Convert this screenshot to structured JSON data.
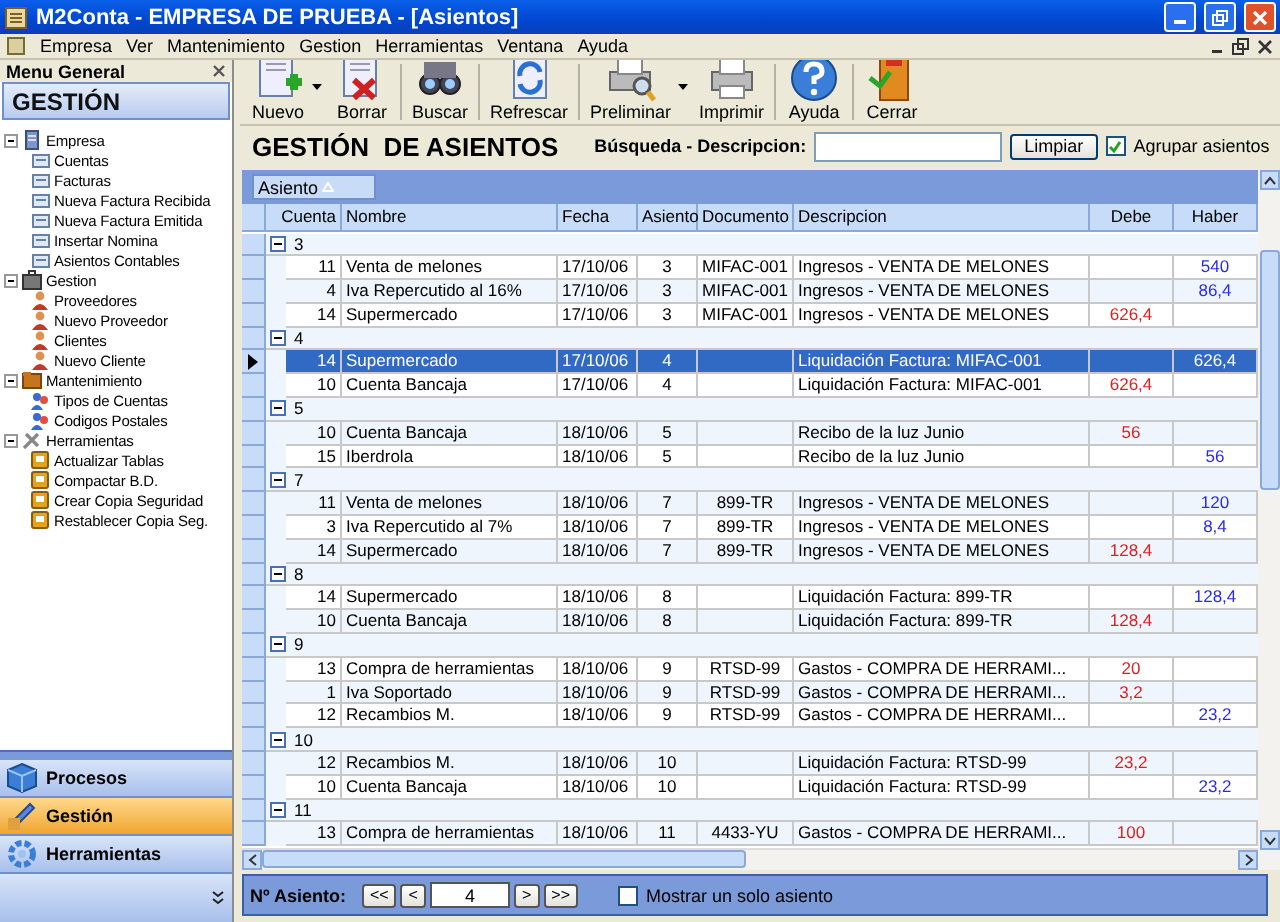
{
  "window": {
    "title": "M2Conta - EMPRESA DE PRUEBA - [Asientos]"
  },
  "menu": [
    "Empresa",
    "Ver",
    "Mantenimiento",
    "Gestion",
    "Herramientas",
    "Ventana",
    "Ayuda"
  ],
  "sidebar": {
    "title": "Menu General",
    "heading": "GESTIÓN",
    "tree": [
      {
        "label": "Empresa",
        "expanded": true,
        "children": [
          {
            "label": "Cuentas"
          },
          {
            "label": "Facturas"
          },
          {
            "label": "Nueva Factura Recibida"
          },
          {
            "label": "Nueva Factura Emitida"
          },
          {
            "label": "Insertar Nomina"
          },
          {
            "label": "Asientos Contables"
          }
        ]
      },
      {
        "label": "Gestion",
        "expanded": true,
        "children": [
          {
            "label": "Proveedores"
          },
          {
            "label": "Nuevo Proveedor"
          },
          {
            "label": "Clientes"
          },
          {
            "label": "Nuevo Cliente"
          }
        ]
      },
      {
        "label": "Mantenimiento",
        "expanded": true,
        "children": [
          {
            "label": "Tipos de Cuentas"
          },
          {
            "label": "Codigos Postales"
          }
        ]
      },
      {
        "label": "Herramientas",
        "expanded": true,
        "children": [
          {
            "label": "Actualizar Tablas"
          },
          {
            "label": "Compactar B.D."
          },
          {
            "label": "Crear Copia Seguridad"
          },
          {
            "label": "Restablecer Copia Seg."
          }
        ]
      }
    ]
  },
  "nav": [
    {
      "label": "Procesos",
      "selected": false
    },
    {
      "label": "Gestión",
      "selected": true
    },
    {
      "label": "Herramientas",
      "selected": false
    }
  ],
  "toolbar": [
    {
      "label": "Nuevo",
      "has_menu": true,
      "separator_after": false
    },
    {
      "label": "Borrar",
      "has_menu": false,
      "separator_after": true
    },
    {
      "label": "Buscar",
      "has_menu": false,
      "separator_after": true
    },
    {
      "label": "Refrescar",
      "has_menu": false,
      "separator_after": true
    },
    {
      "label": "Preliminar",
      "has_menu": true,
      "separator_after": false
    },
    {
      "label": "Imprimir",
      "has_menu": false,
      "separator_after": true
    },
    {
      "label": "Ayuda",
      "has_menu": false,
      "separator_after": true
    },
    {
      "label": "Cerrar",
      "has_menu": false,
      "separator_after": false
    }
  ],
  "heading": "GESTIÓN  DE ASIENTOS",
  "search": {
    "label": "Búsqueda - Descripcion:",
    "button": "Limpiar",
    "group_checkbox": {
      "label": "Agrupar asientos",
      "checked": true
    }
  },
  "grid": {
    "group_by": "Asiento",
    "columns": [
      "Cuenta",
      "Nombre",
      "Fecha",
      "Asiento",
      "Documento",
      "Descripcion",
      "Debe",
      "Haber"
    ],
    "groups": [
      {
        "label": "3",
        "expanded": true,
        "rows": [
          {
            "selected": false,
            "cuenta": "11",
            "nombre": "Venta de melones",
            "fecha": "17/10/06",
            "asiento": "3",
            "documento": "MIFAC-001",
            "descripcion": "Ingresos - VENTA DE MELONES",
            "haber": "540"
          },
          {
            "selected": false,
            "cuenta": "4",
            "nombre": "Iva Repercutido al 16%",
            "fecha": "17/10/06",
            "asiento": "3",
            "documento": "MIFAC-001",
            "descripcion": "Ingresos - VENTA DE MELONES",
            "haber": "86,4"
          },
          {
            "selected": false,
            "cuenta": "14",
            "nombre": "Supermercado",
            "fecha": "17/10/06",
            "asiento": "3",
            "documento": "MIFAC-001",
            "descripcion": "Ingresos - VENTA DE MELONES",
            "debe": "626,4"
          }
        ]
      },
      {
        "label": "4",
        "expanded": true,
        "rows": [
          {
            "selected": true,
            "cuenta": "14",
            "nombre": "Supermercado",
            "fecha": "17/10/06",
            "asiento": "4",
            "descripcion": "Liquidación Factura: MIFAC-001",
            "haber": "626,4"
          },
          {
            "selected": false,
            "cuenta": "10",
            "nombre": "Cuenta Bancaja",
            "fecha": "17/10/06",
            "asiento": "4",
            "descripcion": "Liquidación Factura: MIFAC-001",
            "debe": "626,4"
          }
        ]
      },
      {
        "label": "5",
        "expanded": true,
        "rows": [
          {
            "selected": false,
            "cuenta": "10",
            "nombre": "Cuenta Bancaja",
            "fecha": "18/10/06",
            "asiento": "5",
            "descripcion": "Recibo de la luz Junio",
            "debe": "56"
          },
          {
            "selected": false,
            "cuenta": "15",
            "nombre": "Iberdrola",
            "fecha": "18/10/06",
            "asiento": "5",
            "descripcion": "Recibo de la luz Junio",
            "haber": "56"
          }
        ]
      },
      {
        "label": "7",
        "expanded": true,
        "rows": [
          {
            "selected": false,
            "cuenta": "11",
            "nombre": "Venta de melones",
            "fecha": "18/10/06",
            "asiento": "7",
            "documento": "899-TR",
            "descripcion": "Ingresos - VENTA DE MELONES",
            "haber": "120"
          },
          {
            "selected": false,
            "cuenta": "3",
            "nombre": "Iva Repercutido al 7%",
            "fecha": "18/10/06",
            "asiento": "7",
            "documento": "899-TR",
            "descripcion": "Ingresos - VENTA DE MELONES",
            "haber": "8,4"
          },
          {
            "selected": false,
            "cuenta": "14",
            "nombre": "Supermercado",
            "fecha": "18/10/06",
            "asiento": "7",
            "documento": "899-TR",
            "descripcion": "Ingresos - VENTA DE MELONES",
            "debe": "128,4"
          }
        ]
      },
      {
        "label": "8",
        "expanded": true,
        "rows": [
          {
            "selected": false,
            "cuenta": "14",
            "nombre": "Supermercado",
            "fecha": "18/10/06",
            "asiento": "8",
            "descripcion": "Liquidación Factura: 899-TR",
            "haber": "128,4"
          },
          {
            "selected": false,
            "cuenta": "10",
            "nombre": "Cuenta Bancaja",
            "fecha": "18/10/06",
            "asiento": "8",
            "descripcion": "Liquidación Factura: 899-TR",
            "debe": "128,4"
          }
        ]
      },
      {
        "label": "9",
        "expanded": true,
        "rows": [
          {
            "selected": false,
            "cuenta": "13",
            "nombre": "Compra de herramientas",
            "fecha": "18/10/06",
            "asiento": "9",
            "documento": "RTSD-99",
            "descripcion": "Gastos - COMPRA DE HERRAMI...",
            "debe": "20"
          },
          {
            "selected": false,
            "cuenta": "1",
            "nombre": "Iva Soportado",
            "fecha": "18/10/06",
            "asiento": "9",
            "documento": "RTSD-99",
            "descripcion": "Gastos - COMPRA DE HERRAMI...",
            "debe": "3,2"
          },
          {
            "selected": false,
            "cuenta": "12",
            "nombre": "Recambios M.",
            "fecha": "18/10/06",
            "asiento": "9",
            "documento": "RTSD-99",
            "descripcion": "Gastos - COMPRA DE HERRAMI...",
            "haber": "23,2"
          }
        ]
      },
      {
        "label": "10",
        "expanded": true,
        "rows": [
          {
            "selected": false,
            "cuenta": "12",
            "nombre": "Recambios M.",
            "fecha": "18/10/06",
            "asiento": "10",
            "descripcion": "Liquidación Factura: RTSD-99",
            "debe": "23,2"
          },
          {
            "selected": false,
            "cuenta": "10",
            "nombre": "Cuenta Bancaja",
            "fecha": "18/10/06",
            "asiento": "10",
            "descripcion": "Liquidación Factura: RTSD-99",
            "haber": "23,2"
          }
        ]
      },
      {
        "label": "11",
        "expanded": true,
        "rows": [
          {
            "selected": false,
            "cuenta": "13",
            "nombre": "Compra de herramientas",
            "fecha": "18/10/06",
            "asiento": "11",
            "documento": "4433-YU",
            "descripcion": "Gastos - COMPRA DE HERRAMI...",
            "debe": "100"
          }
        ]
      }
    ]
  },
  "record_nav": {
    "label": "Nº Asiento:",
    "buttons": [
      "<<",
      "<",
      ">",
      ">>"
    ],
    "value": "4",
    "single": {
      "label": "Mostrar un solo asiento",
      "checked": false
    }
  }
}
